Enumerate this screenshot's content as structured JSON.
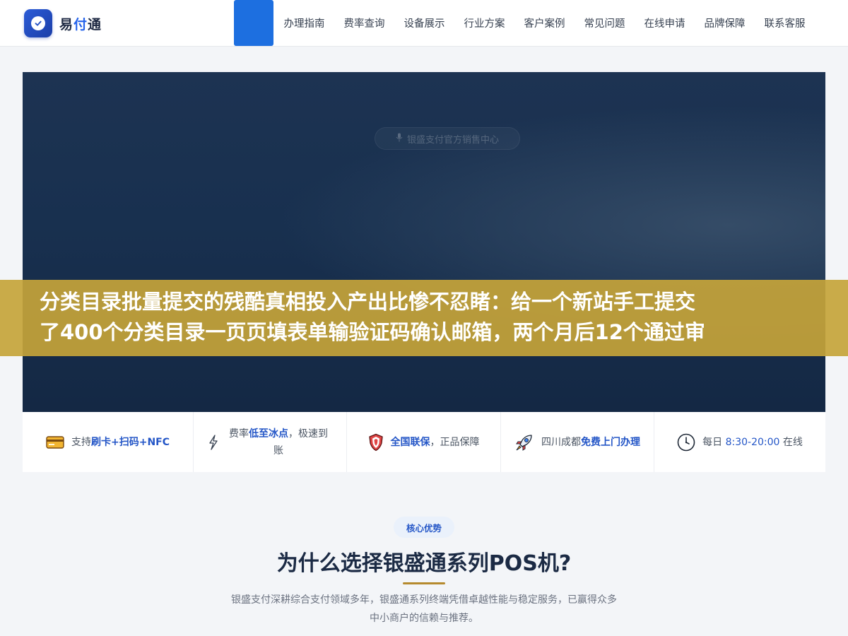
{
  "header": {
    "brand_part1": "易",
    "brand_part2": "付",
    "brand_part3": "通",
    "nav": [
      "办理指南",
      "费率查询",
      "设备展示",
      "行业方案",
      "客户案例",
      "常见问题",
      "在线申请",
      "品牌保障",
      "联系客服"
    ]
  },
  "hero": {
    "badge": "银盛支付官方销售中心",
    "banner_line1": "分类目录批量提交的残酷真相投入产出比惨不忍睹：给一个新站手工提交",
    "banner_line2": "了400个分类目录一页页填表单输验证码确认邮箱，两个月后12个通过审"
  },
  "features": [
    {
      "icon": "credit-card-icon",
      "pre": "支持",
      "em": "刷卡+扫码+NFC",
      "post": ""
    },
    {
      "icon": "lightning-icon",
      "pre": "费率",
      "em": "低至冰点",
      "post": "，极速到账"
    },
    {
      "icon": "shield-icon",
      "pre": "",
      "em": "全国联保",
      "post": "，正品保障"
    },
    {
      "icon": "rocket-icon",
      "pre": "四川成都",
      "em": "免费上门办理",
      "post": ""
    },
    {
      "icon": "clock-icon",
      "pre": "每日 ",
      "em": "8:30-20:00",
      "post": " 在线"
    }
  ],
  "section": {
    "pill": "核心优势",
    "title": "为什么选择银盛通系列POS机?",
    "desc_line1": "银盛支付深耕综合支付领域多年，银盛通系列终端凭借卓越性能与稳定服务，已赢得众多",
    "desc_line2": "中小商户的信赖与推荐。"
  },
  "colors": {
    "accent": "#1d6fe0",
    "brand_blue": "#2456c7",
    "banner_gold": "#c6a43a",
    "hero_navy": "#18304f"
  }
}
